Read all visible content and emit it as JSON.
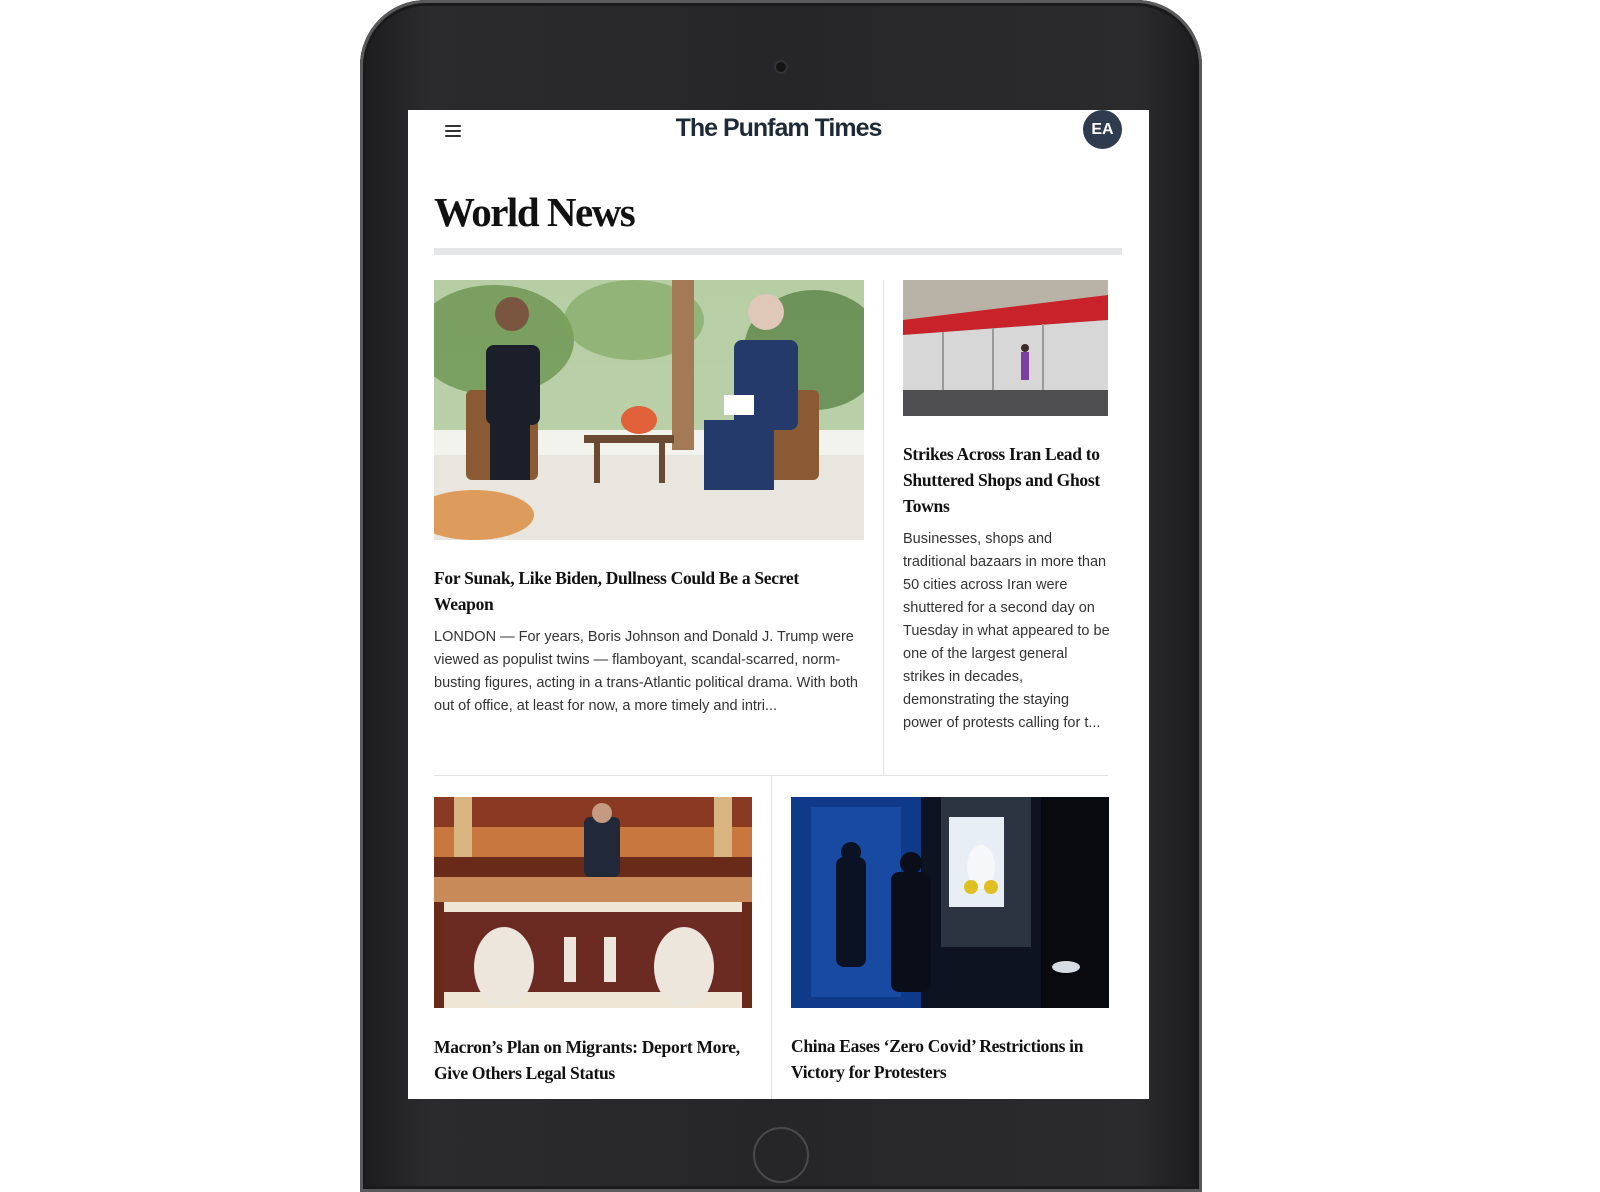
{
  "site": {
    "title": "The Punfam Times",
    "avatar_initials": "EA"
  },
  "section": {
    "title": "World News"
  },
  "stories": [
    {
      "headline": "For Sunak, Like Biden, Dullness Could Be a Secret Weapon",
      "summary": "LONDON — For years, Boris Johnson and Donald J. Trump were viewed as populist twins — flamboyant, scandal-scarred, norm-busting figures, acting in a trans-Atlantic political drama. With both out of office, at least for now, a more timely and intri..."
    },
    {
      "headline": "Strikes Across Iran Lead to Shuttered Shops and Ghost Towns",
      "summary": "Businesses, shops and traditional bazaars in more than 50 cities across Iran were shuttered for a second day on Tuesday in what appeared to be one of the largest general strikes in decades, demonstrating the staying power of protests calling for t..."
    },
    {
      "headline": "Macron’s Plan on Migrants: Deport More, Give Others Legal Status"
    },
    {
      "headline": "China Eases ‘Zero Covid’ Restrictions in Victory for Protesters"
    }
  ],
  "colors": {
    "device_body": "#262628",
    "title_text": "#1f2a37",
    "avatar_bg": "#2f3b4f",
    "section_rule": "#e4e6ea"
  },
  "icons": {
    "menu": "hamburger-menu-icon",
    "camera": "front-camera",
    "home": "home-button"
  }
}
